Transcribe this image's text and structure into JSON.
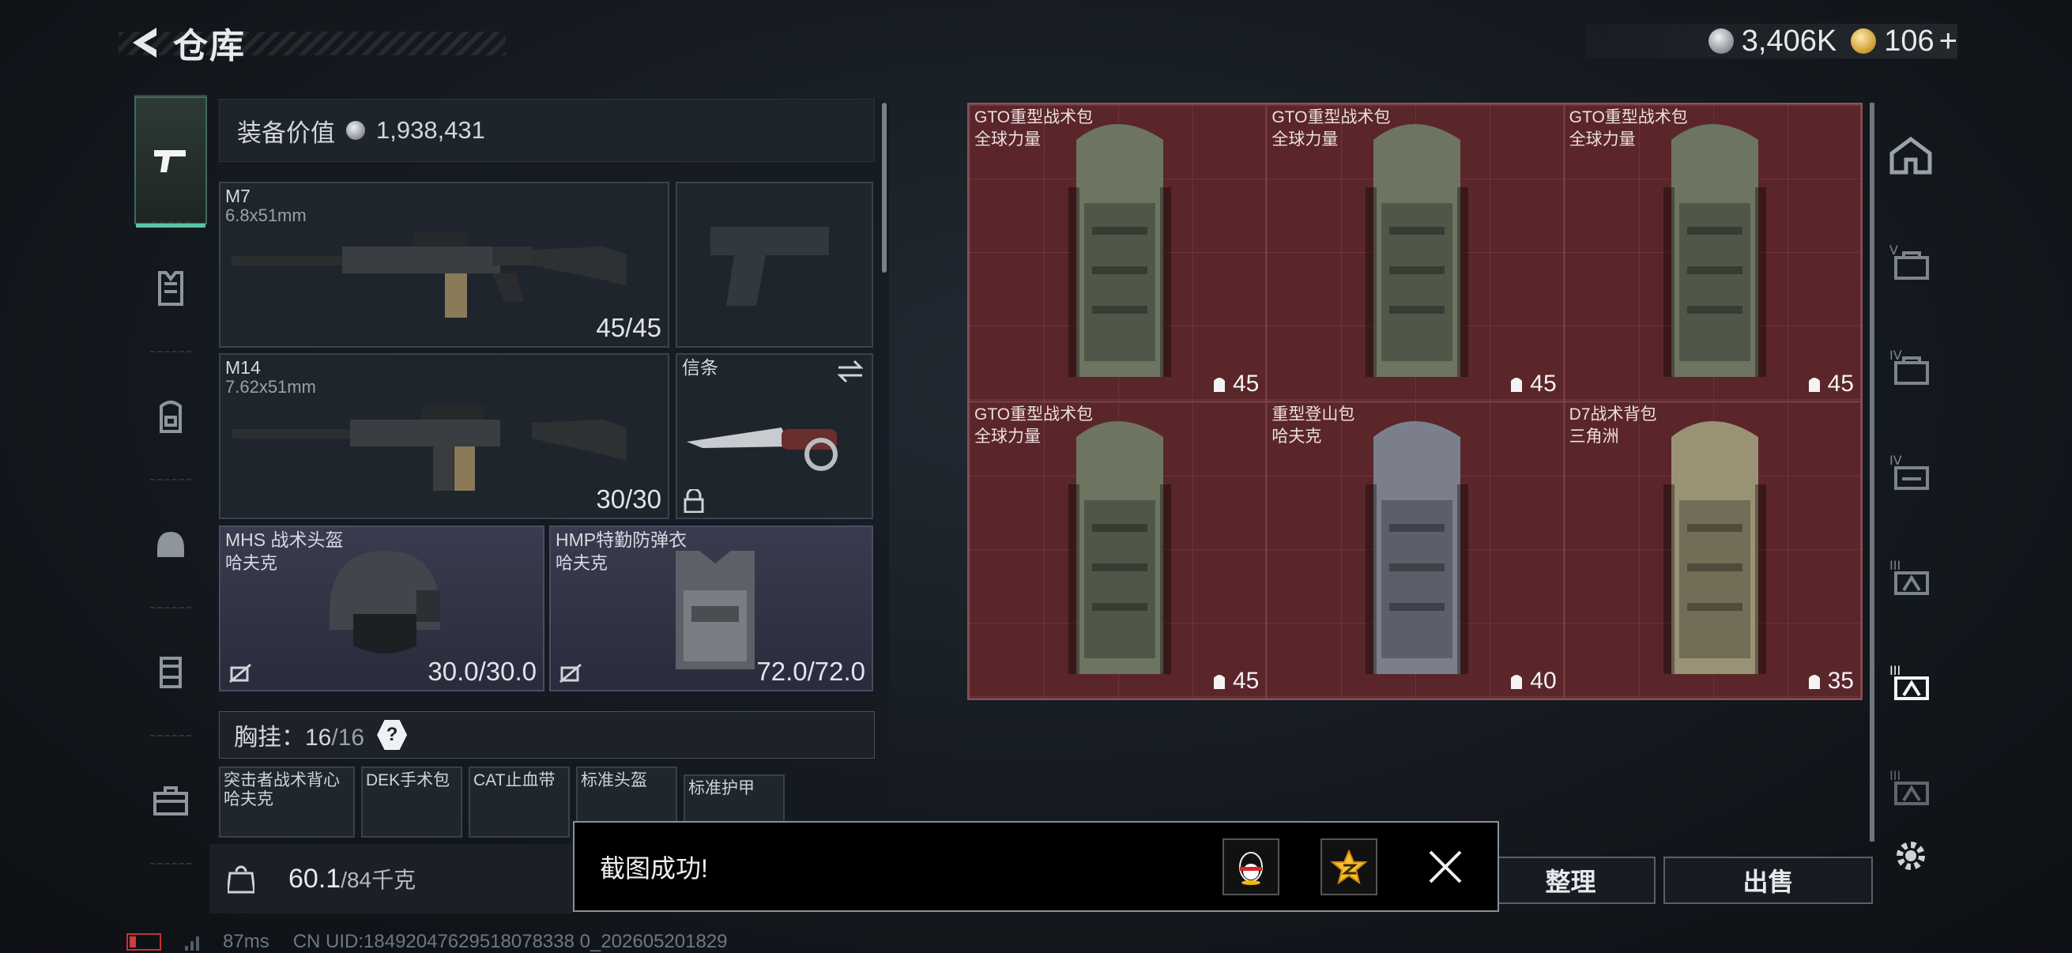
{
  "header": {
    "title": "仓库"
  },
  "currency": {
    "silver": "3,406K",
    "gold": "106",
    "plus": "+"
  },
  "leftnav": [
    "pistol-icon",
    "vest-icon",
    "backpack-icon",
    "helmet-icon",
    "chest-rig-icon",
    "briefcase-icon"
  ],
  "equipment": {
    "value_label": "装备价值",
    "value": "1,938,431",
    "primary": {
      "name": "M7",
      "ammo": "6.8x51mm",
      "count": "45/45"
    },
    "secondary": {
      "name": "M14",
      "ammo": "7.62x51mm",
      "count": "30/30"
    },
    "melee": {
      "name": "信条"
    },
    "helmet": {
      "name": "MHS 战术头盔",
      "brand": "哈夫克",
      "durability": "30.0/30.0"
    },
    "armor": {
      "name": "HMP特勤防弹衣",
      "brand": "哈夫克",
      "durability": "72.0/72.0"
    },
    "chest_rig": {
      "label": "胸挂：",
      "used": "16",
      "sep": "/",
      "total": "16",
      "help": "?"
    },
    "mini_items": [
      {
        "name": "突击者战术背心",
        "brand": "哈夫克"
      },
      {
        "name": "DEK手术包",
        "brand": ""
      },
      {
        "name": "CAT止血带",
        "brand": ""
      },
      {
        "name": "标准头盔",
        "brand": ""
      },
      {
        "name": "标准护甲",
        "brand": ""
      }
    ]
  },
  "weight": {
    "current": "60.1",
    "max": "/84千克"
  },
  "grid_items": [
    {
      "name": "GTO重型战术包",
      "brand": "全球力量",
      "capacity": "45",
      "color": "#6d7560"
    },
    {
      "name": "GTO重型战术包",
      "brand": "全球力量",
      "capacity": "45",
      "color": "#6d7560"
    },
    {
      "name": "GTO重型战术包",
      "brand": "全球力量",
      "capacity": "45",
      "color": "#6d7560"
    },
    {
      "name": "GTO重型战术包",
      "brand": "全球力量",
      "capacity": "45",
      "color": "#6d7560"
    },
    {
      "name": "重型登山包",
      "brand": "哈夫克",
      "capacity": "40",
      "color": "#7b7f8c"
    },
    {
      "name": "D7战术背包",
      "brand": "三角洲",
      "capacity": "35",
      "color": "#9a9275"
    }
  ],
  "rightnav": [
    "all-icon",
    "level-v-icon",
    "level-iv-icon",
    "level-iv-alt-icon",
    "level-iii-icon",
    "level-iii-active-icon",
    "level-ii-icon",
    "settings-icon"
  ],
  "actions": {
    "sort": "整理",
    "sell": "出售"
  },
  "toast": {
    "message": "截图成功!"
  },
  "footer": {
    "ping": "87ms",
    "uid": "CN UID:18492047629518078338 0_202605201829"
  }
}
